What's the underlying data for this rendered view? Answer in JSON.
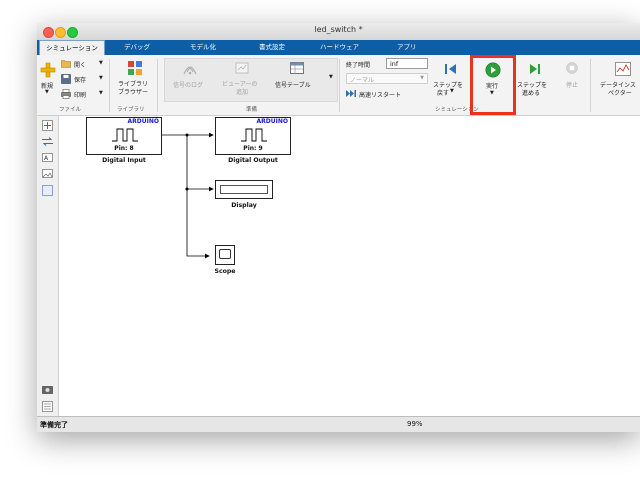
{
  "window": {
    "title": "led_switch *"
  },
  "tabs": [
    {
      "label": "シミュレーション"
    },
    {
      "label": "デバッグ"
    },
    {
      "label": "モデル化"
    },
    {
      "label": "書式設定"
    },
    {
      "label": "ハードウェア"
    },
    {
      "label": "アプリ"
    }
  ],
  "ribbon": {
    "file": {
      "new_label": "新規",
      "open_label": "開く",
      "save_label": "保存",
      "print_label": "印刷",
      "group_label": "ファイル"
    },
    "library": {
      "browser_line1": "ライブラリ",
      "browser_line2": "ブラウザー",
      "group_label": "ライブラリ"
    },
    "prepare": {
      "signal_log": "信号のログ",
      "add_viewer_line1": "ビューアーの",
      "add_viewer_line2": "追加",
      "signal_table": "信号テーブル",
      "group_label": "準備"
    },
    "simulation": {
      "stop_time_label": "終了時間",
      "stop_time_value": "inf",
      "mode_value": "ノーマル",
      "fast_restart": "高速リスタート",
      "step_back_line1": "ステップを",
      "step_back_line2": "戻す",
      "run_label": "実行",
      "step_forward_line1": "ステップを",
      "step_forward_line2": "進める",
      "stop_label": "停止",
      "group_label": "シミュレーション"
    },
    "review": {
      "data_inspector_line1": "データインス",
      "data_inspector_line2": "ペクター"
    }
  },
  "diagram": {
    "blocks": {
      "digital_input": {
        "brand": "ARDUINO",
        "pin": "Pin: 8",
        "label": "Digital Input"
      },
      "digital_output": {
        "brand": "ARDUINO",
        "pin": "Pin: 9",
        "label": "Digital Output"
      },
      "display": {
        "label": "Display"
      },
      "scope": {
        "label": "Scope"
      }
    }
  },
  "status": {
    "text": "準備完了",
    "zoom": "99%"
  },
  "icons": {
    "colors": {
      "accent_blue": "#0c5ea6",
      "run_green": "#2e9d3a",
      "highlight_red": "#e8321e",
      "arduino_blue": "#1a1acc"
    }
  }
}
